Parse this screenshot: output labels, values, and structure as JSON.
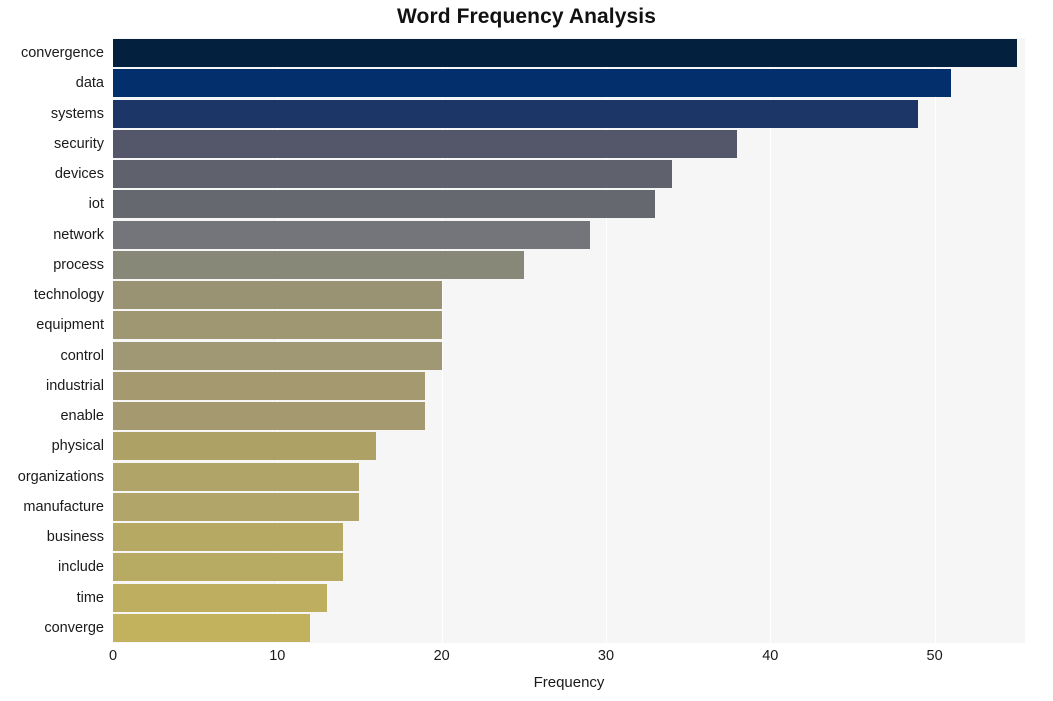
{
  "chart_data": {
    "type": "bar",
    "orientation": "horizontal",
    "title": "Word Frequency Analysis",
    "xlabel": "Frequency",
    "ylabel": "",
    "xlim": [
      0,
      55.5
    ],
    "xticks": [
      0,
      10,
      20,
      30,
      40,
      50
    ],
    "xtick_labels": [
      "0",
      "10",
      "20",
      "30",
      "40",
      "50"
    ],
    "grid": true,
    "grid_axis": "x",
    "legend": null,
    "plot_background": "#f6f6f7",
    "figure_background": "#ffffff",
    "gridline_color": "#ffffff",
    "categories": [
      "convergence",
      "data",
      "systems",
      "security",
      "devices",
      "iot",
      "network",
      "process",
      "technology",
      "equipment",
      "control",
      "industrial",
      "enable",
      "physical",
      "organizations",
      "manufacture",
      "business",
      "include",
      "time",
      "converge"
    ],
    "values": [
      55,
      51,
      49,
      38,
      34,
      33,
      29,
      25,
      20,
      20,
      20,
      19,
      19,
      16,
      15,
      15,
      14,
      14,
      13,
      12
    ],
    "bar_colors": [
      "#04203f",
      "#032f6c",
      "#1b3667",
      "#535769",
      "#5f616d",
      "#66686f",
      "#74757a",
      "#888878",
      "#9a9373",
      "#9f9672",
      "#a09774",
      "#a59a6f",
      "#a59a6f",
      "#ada165",
      "#b0a468",
      "#b2a56a",
      "#b6a964",
      "#b7aa63",
      "#bdae60",
      "#c2b25e"
    ]
  }
}
